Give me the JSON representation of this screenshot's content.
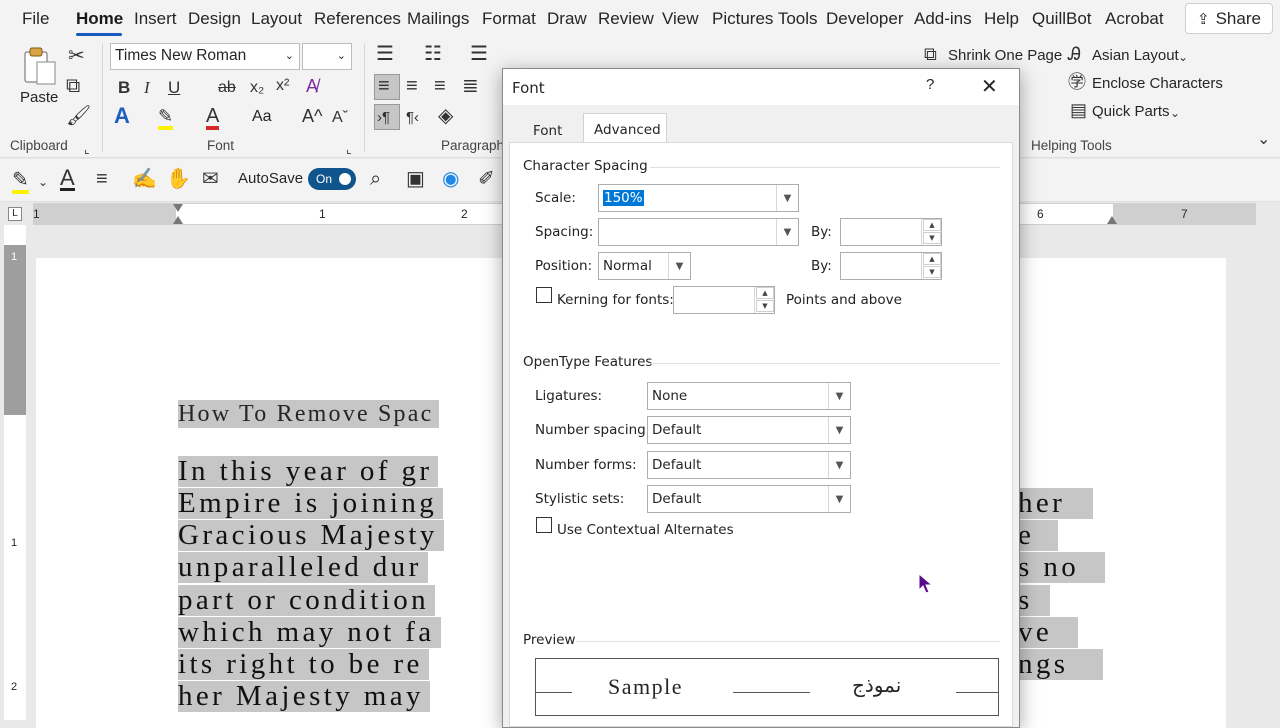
{
  "menu": {
    "tabs": [
      "File",
      "Home",
      "Insert",
      "Design",
      "Layout",
      "References",
      "Mailings",
      "Format",
      "Draw",
      "Review",
      "View",
      "Pictures Tools",
      "Developer",
      "Add-ins",
      "Help",
      "QuillBot",
      "Acrobat"
    ],
    "share_label": "Share"
  },
  "ribbon": {
    "clipboard": {
      "paste_label": "Paste",
      "group_label": "Clipboard"
    },
    "font": {
      "font_name": "Times New Roman",
      "font_size": "",
      "group_label": "Font",
      "change_case": "Aa"
    },
    "paragraph": {
      "group_label": "Paragraph"
    },
    "helping_tools": {
      "shrink_one_page": "Shrink One Page",
      "asian_layout": "Asian Layout",
      "enclose_characters": "Enclose Characters",
      "quick_parts": "Quick Parts",
      "group_label": "Helping Tools"
    }
  },
  "qat": {
    "autosave_label": "AutoSave",
    "autosave_state": "On"
  },
  "ruler": {
    "numbers": [
      "1",
      "1",
      "2",
      "6",
      "7"
    ],
    "vertical_numbers": [
      "1",
      "1",
      "2"
    ]
  },
  "document": {
    "heading": "How To Remove Spac",
    "lines": [
      {
        "left": "In this year of gr",
        "right": ""
      },
      {
        "left": "Empire is joining",
        "right": "her"
      },
      {
        "left": "Gracious Majesty",
        "right": "e"
      },
      {
        "left": "unparalleled dur",
        "right": "s no"
      },
      {
        "left": "part or condition",
        "right": "s"
      },
      {
        "left": "which may not fa",
        "right": "ve"
      },
      {
        "left": "its right to be re",
        "right": "ngs"
      },
      {
        "left": "her Majesty may",
        "right": ""
      }
    ]
  },
  "dialog": {
    "title": "Font",
    "help": "?",
    "tabs": {
      "font": "Font",
      "advanced": "Advanced"
    },
    "character_spacing": {
      "section_title": "Character Spacing",
      "scale_label": "Scale:",
      "scale_value": "150%",
      "spacing_label": "Spacing:",
      "spacing_value": "",
      "spacing_by_label": "By:",
      "position_label": "Position:",
      "position_value": "Normal",
      "position_by_label": "By:",
      "kerning_label": "Kerning for fonts:",
      "kerning_suffix": "Points and above",
      "kerning_checked": false
    },
    "opentype": {
      "section_title": "OpenType Features",
      "ligatures_label": "Ligatures:",
      "ligatures_value": "None",
      "number_spacing_label": "Number spacing:",
      "number_spacing_value": "Default",
      "number_forms_label": "Number forms:",
      "number_forms_value": "Default",
      "stylistic_sets_label": "Stylistic sets:",
      "stylistic_sets_value": "Default",
      "contextual_label": "Use Contextual Alternates",
      "contextual_checked": false
    },
    "preview": {
      "section_title": "Preview",
      "sample_text": "Sample",
      "sample_arabic": "نموذج"
    }
  },
  "colors": {
    "accent": "#185abd",
    "toggle": "#0f548c",
    "selection": "#0078d7",
    "highlight": "#c6c6c6",
    "cursor": "#5a0a8c"
  }
}
